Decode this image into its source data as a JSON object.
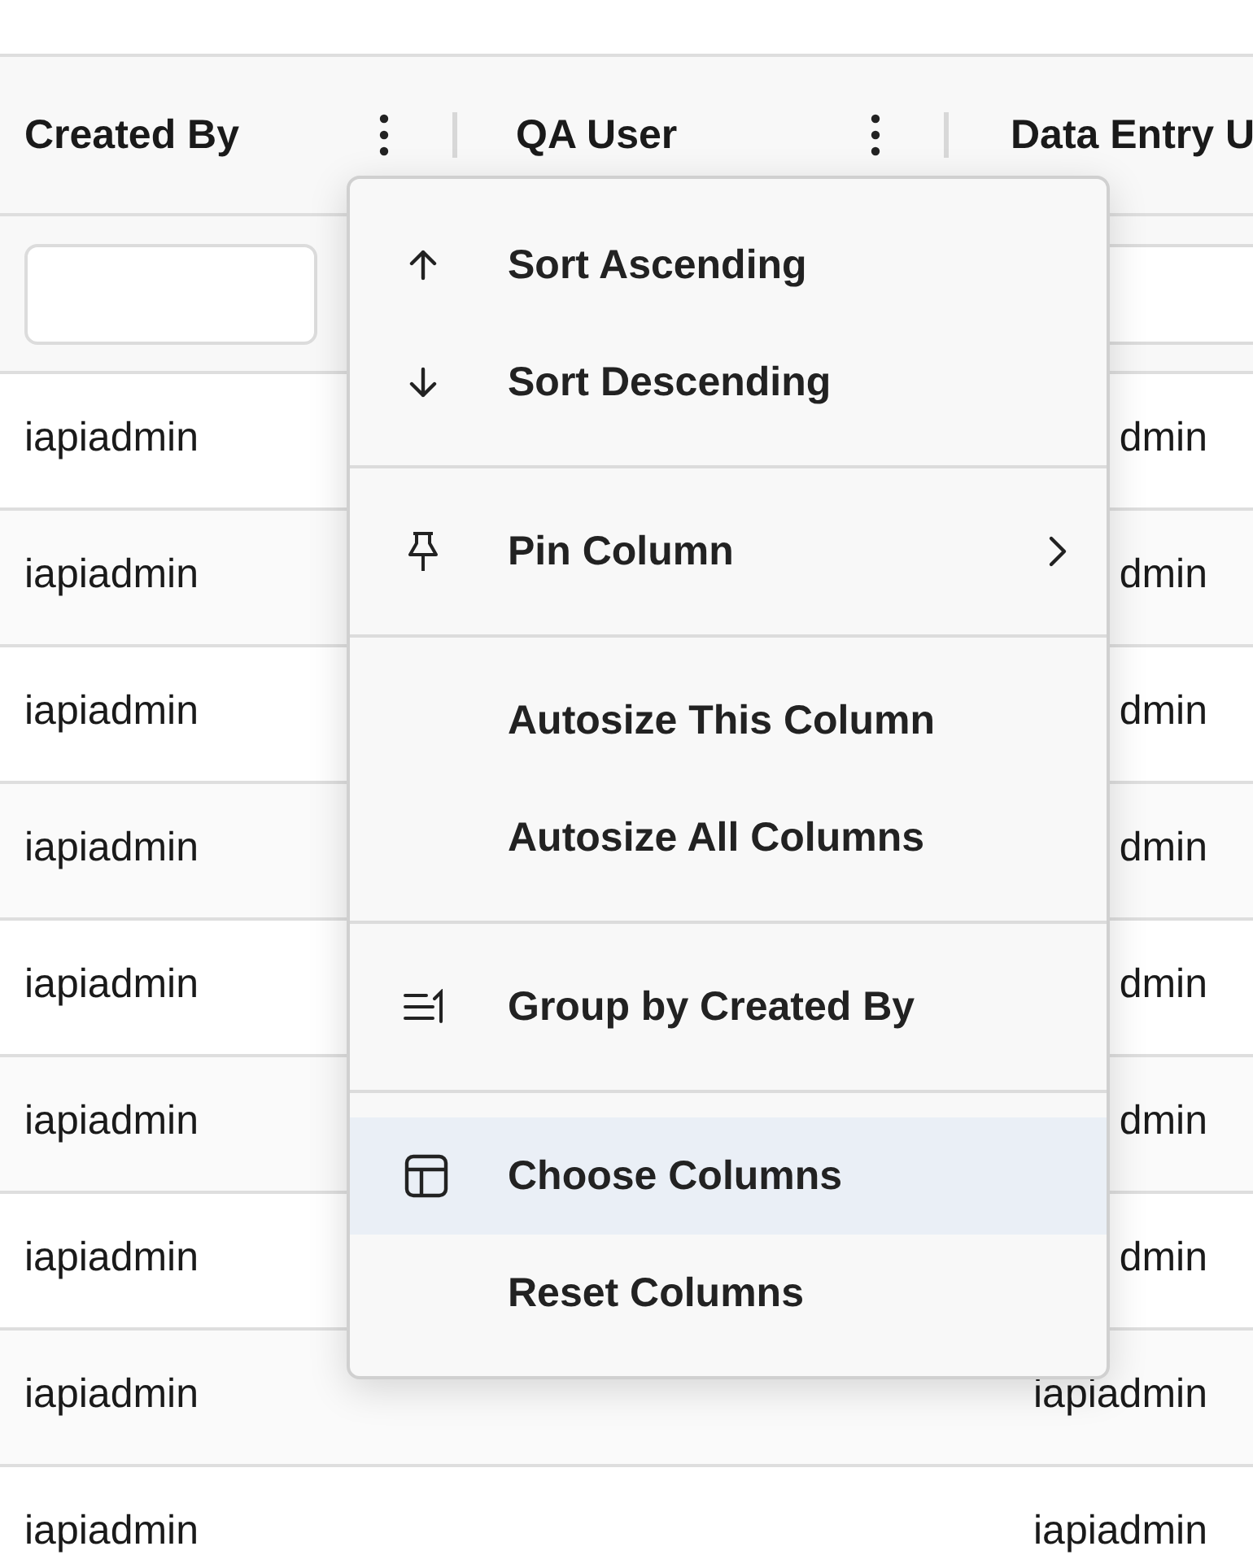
{
  "table": {
    "columns": [
      {
        "label": "Created By",
        "has_menu": true,
        "filter": true
      },
      {
        "label": "QA User",
        "has_menu": true,
        "filter": false
      },
      {
        "label": "Data Entry U",
        "has_menu": false,
        "filter": true
      }
    ],
    "rows": [
      {
        "created_by": "iapiadmin",
        "column_3": "dmin"
      },
      {
        "created_by": "iapiadmin",
        "column_3": "dmin"
      },
      {
        "created_by": "iapiadmin",
        "column_3": "dmin"
      },
      {
        "created_by": "iapiadmin",
        "column_3": "dmin"
      },
      {
        "created_by": "iapiadmin",
        "column_3": "dmin"
      },
      {
        "created_by": "iapiadmin",
        "column_3": "dmin"
      },
      {
        "created_by": "iapiadmin",
        "column_3": "dmin"
      },
      {
        "created_by": "iapiadmin",
        "column_3": "iapiadmin"
      },
      {
        "created_by": "iapiadmin",
        "column_3": "iapiadmin"
      }
    ]
  },
  "column_menu": {
    "sections": [
      {
        "items": [
          {
            "label": "Sort Ascending",
            "kind": "sort-asc",
            "submenu": false,
            "selected": false
          },
          {
            "label": "Sort Descending",
            "kind": "sort-desc",
            "submenu": false,
            "selected": false
          }
        ]
      },
      {
        "items": [
          {
            "label": "Pin Column",
            "kind": "pin",
            "submenu": true,
            "selected": false
          }
        ]
      },
      {
        "items": [
          {
            "label": "Autosize This Column",
            "kind": "autosize",
            "submenu": false,
            "selected": false
          },
          {
            "label": "Autosize All Columns",
            "kind": "autosize",
            "submenu": false,
            "selected": false
          }
        ]
      },
      {
        "items": [
          {
            "label": "Group by Created By",
            "kind": "group",
            "submenu": false,
            "selected": false
          }
        ]
      },
      {
        "items": [
          {
            "label": "Choose Columns",
            "kind": "columns",
            "submenu": false,
            "selected": true
          },
          {
            "label": "Reset Columns",
            "kind": "reset",
            "submenu": false,
            "selected": false
          }
        ]
      }
    ]
  }
}
